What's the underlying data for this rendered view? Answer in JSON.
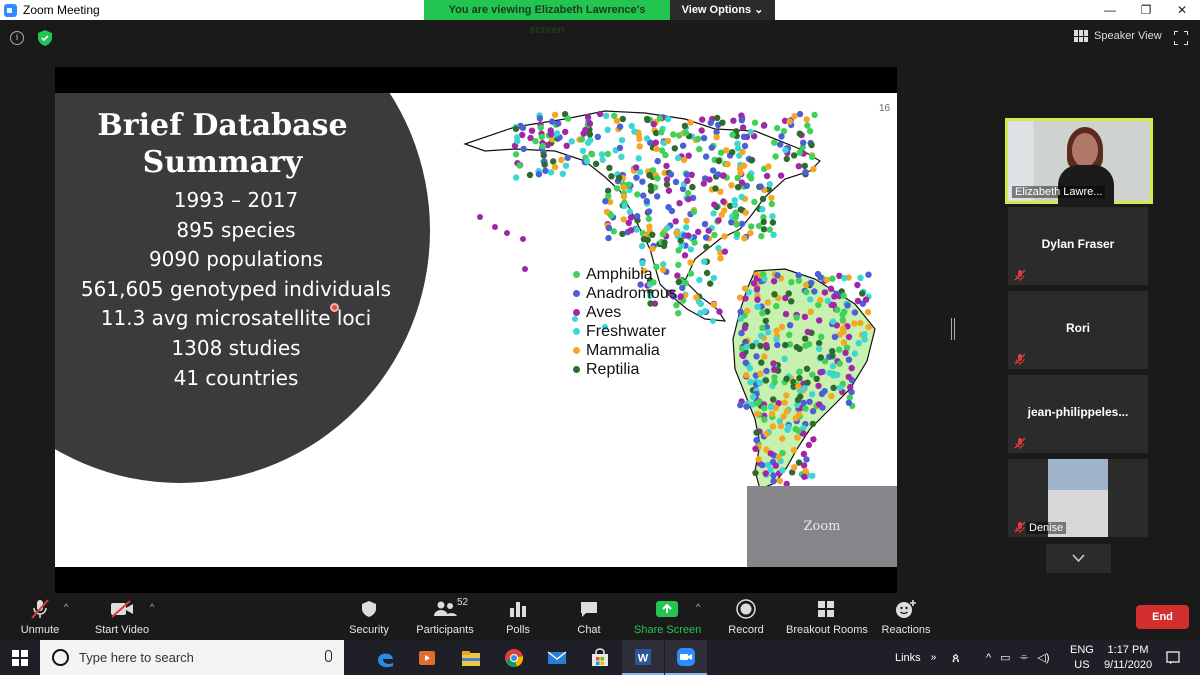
{
  "window": {
    "title": "Zoom Meeting"
  },
  "share_banner": {
    "viewing_text": "You are viewing Elizabeth Lawrence's screen",
    "view_options_label": "View Options ⌄"
  },
  "top_right": {
    "speaker_view_label": "Speaker View"
  },
  "slide": {
    "title_line1": "Brief Database",
    "title_line2": "Summary",
    "stats": [
      "1993 – 2017",
      "895 species",
      "9090 populations",
      "561,605 genotyped individuals",
      "11.3 avg microsatellite loci",
      "1308 studies",
      "41 countries"
    ],
    "page_number": "16",
    "legend": [
      {
        "label": "Amphibia",
        "color": "#3fd158"
      },
      {
        "label": "Anadromous",
        "color": "#4a5fd8"
      },
      {
        "label": "Aves",
        "color": "#a325a8"
      },
      {
        "label": "Freshwater",
        "color": "#3dd6d0"
      },
      {
        "label": "Mammalia",
        "color": "#f5a623"
      },
      {
        "label": "Reptilia",
        "color": "#2e6b2e"
      }
    ],
    "zoom_watermark": "Zoom"
  },
  "participants": [
    {
      "name": "Elizabeth Lawre...",
      "video": true
    },
    {
      "name": "Dylan Fraser",
      "muted": true
    },
    {
      "name": "Rori",
      "muted": true
    },
    {
      "name": "jean-philippeles...",
      "muted": true
    },
    {
      "name": "Denise",
      "muted": true,
      "video": true
    }
  ],
  "toolbar": {
    "unmute": "Unmute",
    "start_video": "Start Video",
    "security": "Security",
    "participants": "Participants",
    "participants_count": "52",
    "polls": "Polls",
    "chat": "Chat",
    "share_screen": "Share Screen",
    "record": "Record",
    "breakout_rooms": "Breakout Rooms",
    "reactions": "Reactions",
    "end": "End"
  },
  "taskbar": {
    "search_placeholder": "Type here to search",
    "links_label": "Links",
    "lang_top": "ENG",
    "lang_bottom": "US",
    "time": "1:17 PM",
    "date": "9/11/2020"
  }
}
